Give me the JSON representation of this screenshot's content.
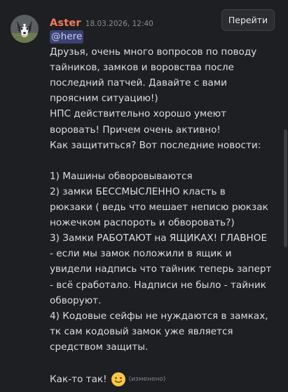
{
  "message": {
    "author": "Aster",
    "timestamp": "18.03.2026, 12:40",
    "jump_label": "Перейти",
    "mention": "@here",
    "lines": [
      "Друзья, очень много вопросов по поводу",
      "тайников, замков и воровства после",
      "последний патчей. Давайте с вами",
      "проясним ситуацию!)",
      "НПС действительно хорошо умеют",
      "воровать! Причем очень активно!",
      "Как защититься? Вот последние новости:",
      "",
      "1) Машины обворовываются",
      "2) замки БЕССМЫСЛЕННО класть в",
      "рюкзаки ( ведь что мешает неписю рюкзак",
      "ножечком распороть и обворовать?)",
      "3) Замки РАБОТАЮТ на ЯЩИКАХ! ГЛАВНОЕ",
      "- если мы замок положили в ящик и",
      "увидели надпись что тайник теперь заперт",
      "- всё сработало. Надписи не было - тайник",
      "обворуют.",
      "4) Кодовые сейфы не нуждаются в замках,",
      "тк сам кодовый замок уже является",
      "средством защиты.",
      ""
    ],
    "last_line": "Как-то так!",
    "emoji": "slightly-smiling-face",
    "edited": "(изменено)"
  },
  "colors": {
    "background": "#1e1f22",
    "username": "#f57d5d",
    "mention_bg": "#3c4270",
    "text": "#dbdee1"
  }
}
